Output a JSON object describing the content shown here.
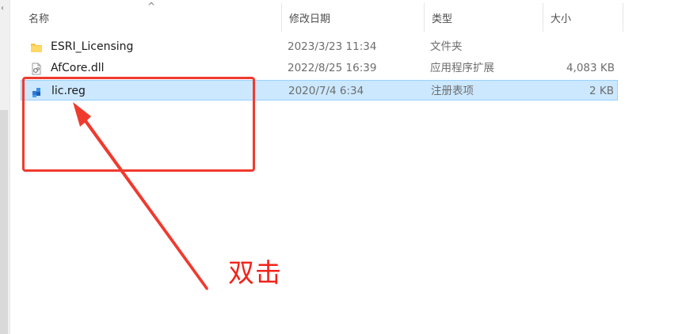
{
  "header": {
    "name": "名称",
    "date": "修改日期",
    "type": "类型",
    "size": "大小",
    "sort_indicator": "^"
  },
  "files": [
    {
      "name": "ESRI_Licensing",
      "date": "2023/3/23 11:34",
      "type": "文件夹",
      "size": "",
      "icon": "folder-icon",
      "selected": false
    },
    {
      "name": "AfCore.dll",
      "date": "2022/8/25 16:39",
      "type": "应用程序扩展",
      "size": "4,083 KB",
      "icon": "dll-file-icon",
      "selected": false
    },
    {
      "name": "lic.reg",
      "date": "2020/7/4 6:34",
      "type": "注册表项",
      "size": "2 KB",
      "icon": "registry-file-icon",
      "selected": true
    }
  ],
  "annotation": {
    "label": "双击",
    "color": "#f2231a"
  },
  "colors": {
    "selection_bg": "#cce8ff",
    "selection_border": "#99d1ff",
    "annotation_red": "#f03a2e"
  }
}
